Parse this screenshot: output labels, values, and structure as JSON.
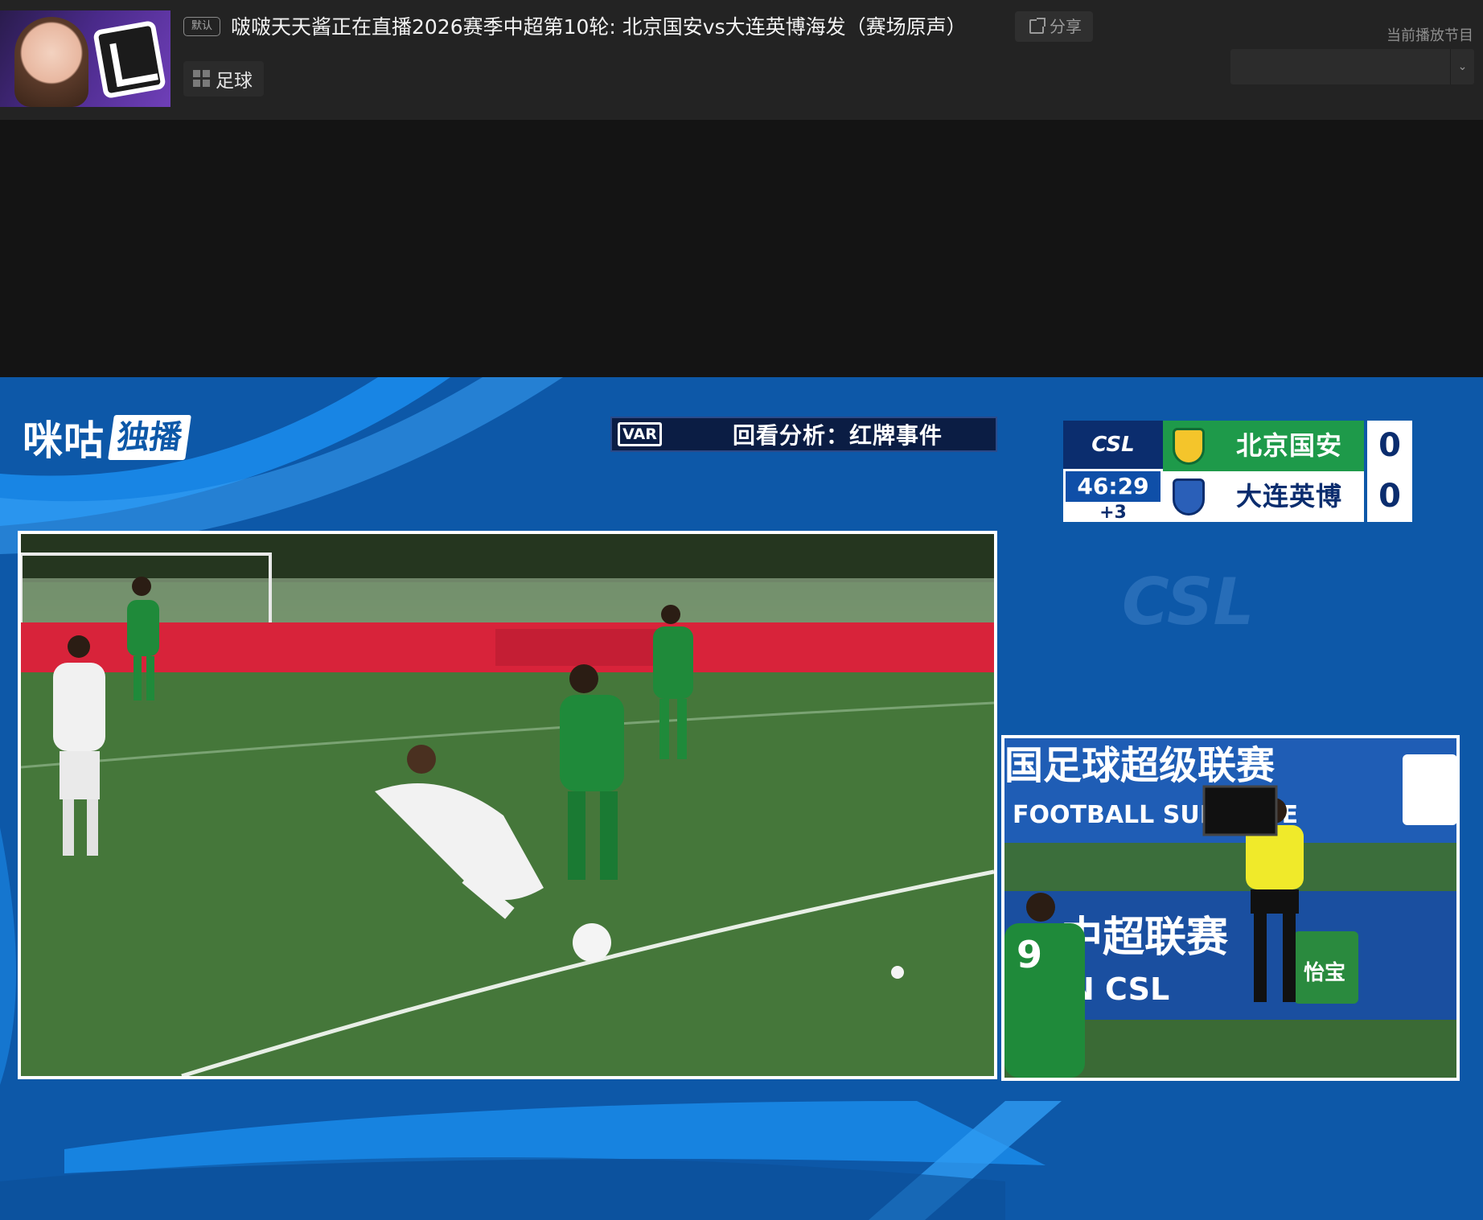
{
  "header": {
    "badge": "默认",
    "title": "啵啵天天酱正在直播2026赛季中超第10轮: 北京国安vs大连英博海发（赛场原声）",
    "share_label": "分享",
    "category": "足球",
    "now_playing_label": "当前播放节目",
    "program_select_value": ""
  },
  "broadcast": {
    "channel_logo": "咪咕",
    "channel_exclusive": "独播",
    "var_icon": "VAR",
    "var_title": "回看分析：红牌事件",
    "scoreboard": {
      "league": "CSL",
      "clock": "46:29",
      "added_time": "+3",
      "home_team": "北京国安",
      "home_score": "0",
      "away_team": "大连英博",
      "away_score": "0"
    },
    "watermark": "CSL",
    "side_banner_line1": "国足球超级联赛",
    "side_banner_line2": "FOOTBALL SUPE  GUE",
    "side_board_line1": "中超联赛",
    "side_board_line2": "N CSL",
    "side_sponsor": "怡宝"
  },
  "colors": {
    "broadcast_blue": "#0d58a8",
    "home_green": "#1e9a4a",
    "header_bg": "#232323"
  }
}
